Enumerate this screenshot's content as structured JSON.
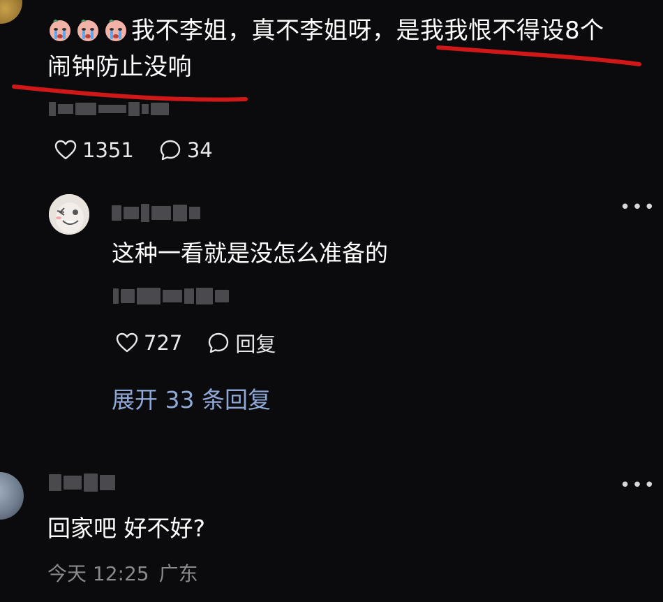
{
  "top_comment": {
    "text_line1_a": "我不李姐，真不李姐呀，",
    "text_line1_b": "是我我恨不得设8个",
    "text_line2": "闹钟防止没响",
    "emoji_icon": "crying-face-emoji",
    "likes": "1351",
    "comments": "34"
  },
  "reply": {
    "text": "这种一看就是没怎么准备的",
    "likes": "727",
    "reply_label": "回复",
    "more_icon": "more-dots-icon"
  },
  "expand_replies": "展开 33 条回复",
  "second_comment": {
    "text": "回家吧 好不好?",
    "time": "今天 12:25",
    "location": "广东"
  },
  "colors": {
    "background": "#0b0b0d",
    "underline": "#d01818",
    "link": "#8fa8d6",
    "muted": "#8a8a8e"
  }
}
